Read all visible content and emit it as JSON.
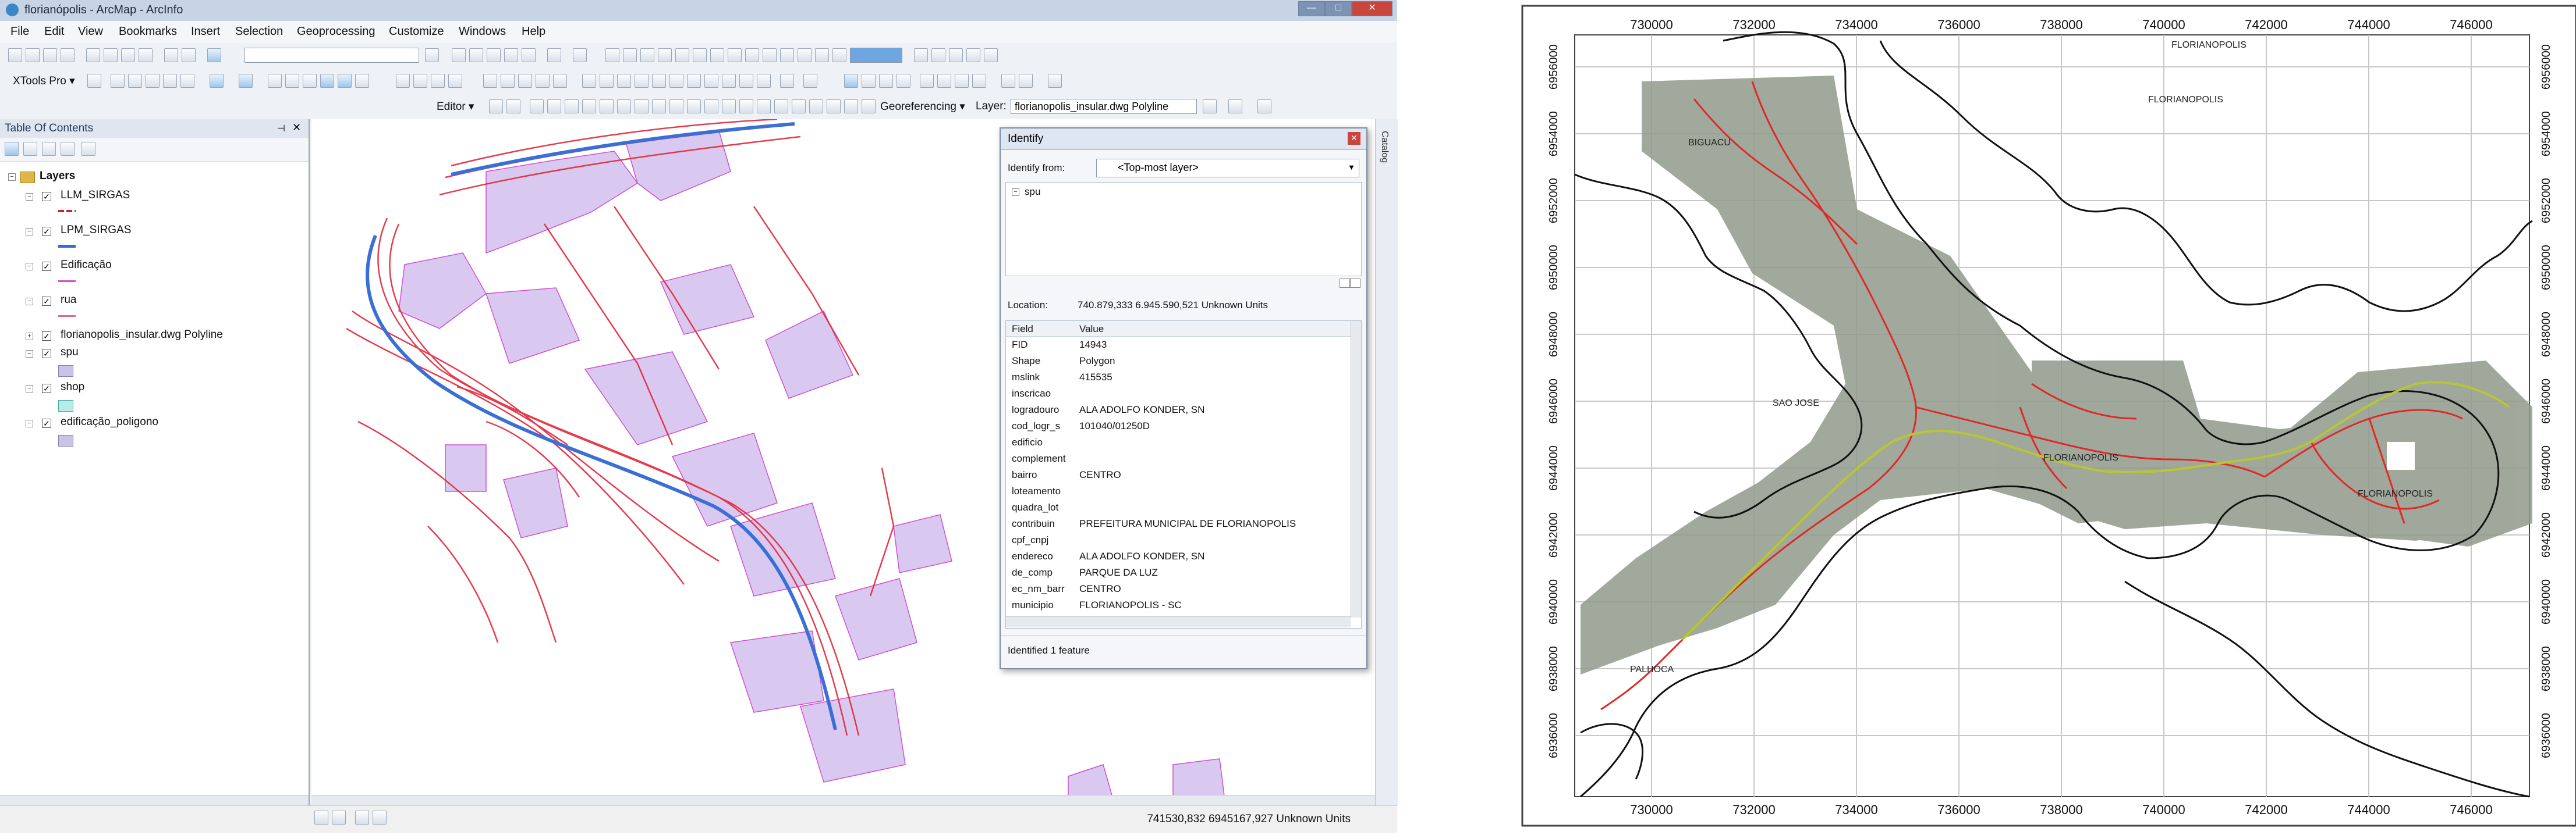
{
  "window": {
    "title": "florianópolis - ArcMap - ArcInfo",
    "minimize": "—",
    "maximize": "□",
    "close": "✕"
  },
  "menu": [
    "File",
    "Edit",
    "View",
    "Bookmarks",
    "Insert",
    "Selection",
    "Geoprocessing",
    "Customize",
    "Windows",
    "Help"
  ],
  "toolbars": {
    "xtools_label": "XTools Pro ▾",
    "editor_label": "Editor ▾",
    "georef_label": "Georeferencing ▾",
    "layer_label": "Layer:",
    "layer_value": "florianopolis_insular.dwg Polyline"
  },
  "toc": {
    "title": "Table Of Contents",
    "root": "Layers",
    "layers": [
      {
        "name": "LLM_SIRGAS",
        "checked": true,
        "symbol": "#d01e2b"
      },
      {
        "name": "LPM_SIRGAS",
        "checked": true,
        "symbol": "#2f6fd1"
      },
      {
        "name": "Edificação",
        "checked": true,
        "symbol": "#d14fcf"
      },
      {
        "name": "rua",
        "checked": true,
        "symbol": "#d01e2b"
      },
      {
        "name": "florianopolis_insular.dwg Polyline",
        "checked": true,
        "symbol": ""
      },
      {
        "name": "spu",
        "checked": true,
        "symbol": "#c9c3e8"
      },
      {
        "name": "shop",
        "checked": true,
        "symbol": "#b8ece8"
      },
      {
        "name": "edificação_poligono",
        "checked": true,
        "symbol": "#c9c3e8"
      }
    ]
  },
  "identify": {
    "title": "Identify",
    "from_label": "Identify from:",
    "from_value": "<Top-most layer>",
    "tree_node": "spu",
    "location_label": "Location:",
    "location_value": "740.879,333  6.945.590,521 Unknown Units",
    "field_header": "Field",
    "value_header": "Value",
    "rows": [
      {
        "field": "FID",
        "value": "14943"
      },
      {
        "field": "Shape",
        "value": "Polygon"
      },
      {
        "field": "mslink",
        "value": "415535"
      },
      {
        "field": "inscricao",
        "value": ""
      },
      {
        "field": "logradouro",
        "value": "ALA ADOLFO KONDER, SN"
      },
      {
        "field": "cod_logr_s",
        "value": "101040/01250D"
      },
      {
        "field": "edificio",
        "value": ""
      },
      {
        "field": "complement",
        "value": ""
      },
      {
        "field": "bairro",
        "value": "CENTRO"
      },
      {
        "field": "loteamento",
        "value": ""
      },
      {
        "field": "quadra_lot",
        "value": ""
      },
      {
        "field": "contribuin",
        "value": "PREFEITURA MUNICIPAL DE FLORIANOPOLIS"
      },
      {
        "field": "cpf_cnpj",
        "value": ""
      },
      {
        "field": "endereco",
        "value": "ALA ADOLFO KONDER, SN"
      },
      {
        "field": "de_comp",
        "value": "PARQUE DA LUZ"
      },
      {
        "field": "ec_nm_barr",
        "value": "CENTRO"
      },
      {
        "field": "municipio",
        "value": "FLORIANOPOLIS - SC"
      }
    ],
    "footer": "Identified 1 feature"
  },
  "status": {
    "coords": "741530,832  6945167,927 Unknown Units"
  },
  "catalog_label": "Catalog",
  "overview_map": {
    "x_ticks": [
      "730000",
      "732000",
      "734000",
      "736000",
      "738000",
      "740000",
      "742000",
      "744000",
      "746000"
    ],
    "y_ticks": [
      "6956000",
      "6954000",
      "6952000",
      "6950000",
      "6948000",
      "6946000",
      "6944000",
      "6942000",
      "6940000",
      "6938000",
      "6936000"
    ],
    "place_labels": [
      {
        "text": "FLORIANOPOLIS"
      },
      {
        "text": "FLORIANOPOLIS"
      },
      {
        "text": "BIGUACU"
      },
      {
        "text": "SAO JOSE"
      },
      {
        "text": "FLORIANOPOLIS"
      },
      {
        "text": "FLORIANOPOLIS"
      },
      {
        "text": "PALHOCA"
      }
    ]
  }
}
